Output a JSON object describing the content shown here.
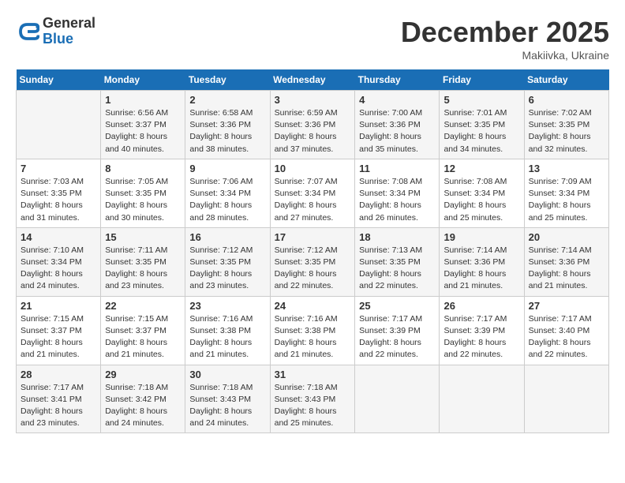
{
  "header": {
    "logo": {
      "line1": "General",
      "line2": "Blue"
    },
    "title": "December 2025",
    "location": "Makiivka, Ukraine"
  },
  "weekdays": [
    "Sunday",
    "Monday",
    "Tuesday",
    "Wednesday",
    "Thursday",
    "Friday",
    "Saturday"
  ],
  "weeks": [
    [
      {
        "day": "",
        "sunrise": "",
        "sunset": "",
        "daylight": ""
      },
      {
        "day": "1",
        "sunrise": "Sunrise: 6:56 AM",
        "sunset": "Sunset: 3:37 PM",
        "daylight": "Daylight: 8 hours and 40 minutes."
      },
      {
        "day": "2",
        "sunrise": "Sunrise: 6:58 AM",
        "sunset": "Sunset: 3:36 PM",
        "daylight": "Daylight: 8 hours and 38 minutes."
      },
      {
        "day": "3",
        "sunrise": "Sunrise: 6:59 AM",
        "sunset": "Sunset: 3:36 PM",
        "daylight": "Daylight: 8 hours and 37 minutes."
      },
      {
        "day": "4",
        "sunrise": "Sunrise: 7:00 AM",
        "sunset": "Sunset: 3:36 PM",
        "daylight": "Daylight: 8 hours and 35 minutes."
      },
      {
        "day": "5",
        "sunrise": "Sunrise: 7:01 AM",
        "sunset": "Sunset: 3:35 PM",
        "daylight": "Daylight: 8 hours and 34 minutes."
      },
      {
        "day": "6",
        "sunrise": "Sunrise: 7:02 AM",
        "sunset": "Sunset: 3:35 PM",
        "daylight": "Daylight: 8 hours and 32 minutes."
      }
    ],
    [
      {
        "day": "7",
        "sunrise": "Sunrise: 7:03 AM",
        "sunset": "Sunset: 3:35 PM",
        "daylight": "Daylight: 8 hours and 31 minutes."
      },
      {
        "day": "8",
        "sunrise": "Sunrise: 7:05 AM",
        "sunset": "Sunset: 3:35 PM",
        "daylight": "Daylight: 8 hours and 30 minutes."
      },
      {
        "day": "9",
        "sunrise": "Sunrise: 7:06 AM",
        "sunset": "Sunset: 3:34 PM",
        "daylight": "Daylight: 8 hours and 28 minutes."
      },
      {
        "day": "10",
        "sunrise": "Sunrise: 7:07 AM",
        "sunset": "Sunset: 3:34 PM",
        "daylight": "Daylight: 8 hours and 27 minutes."
      },
      {
        "day": "11",
        "sunrise": "Sunrise: 7:08 AM",
        "sunset": "Sunset: 3:34 PM",
        "daylight": "Daylight: 8 hours and 26 minutes."
      },
      {
        "day": "12",
        "sunrise": "Sunrise: 7:08 AM",
        "sunset": "Sunset: 3:34 PM",
        "daylight": "Daylight: 8 hours and 25 minutes."
      },
      {
        "day": "13",
        "sunrise": "Sunrise: 7:09 AM",
        "sunset": "Sunset: 3:34 PM",
        "daylight": "Daylight: 8 hours and 25 minutes."
      }
    ],
    [
      {
        "day": "14",
        "sunrise": "Sunrise: 7:10 AM",
        "sunset": "Sunset: 3:34 PM",
        "daylight": "Daylight: 8 hours and 24 minutes."
      },
      {
        "day": "15",
        "sunrise": "Sunrise: 7:11 AM",
        "sunset": "Sunset: 3:35 PM",
        "daylight": "Daylight: 8 hours and 23 minutes."
      },
      {
        "day": "16",
        "sunrise": "Sunrise: 7:12 AM",
        "sunset": "Sunset: 3:35 PM",
        "daylight": "Daylight: 8 hours and 23 minutes."
      },
      {
        "day": "17",
        "sunrise": "Sunrise: 7:12 AM",
        "sunset": "Sunset: 3:35 PM",
        "daylight": "Daylight: 8 hours and 22 minutes."
      },
      {
        "day": "18",
        "sunrise": "Sunrise: 7:13 AM",
        "sunset": "Sunset: 3:35 PM",
        "daylight": "Daylight: 8 hours and 22 minutes."
      },
      {
        "day": "19",
        "sunrise": "Sunrise: 7:14 AM",
        "sunset": "Sunset: 3:36 PM",
        "daylight": "Daylight: 8 hours and 21 minutes."
      },
      {
        "day": "20",
        "sunrise": "Sunrise: 7:14 AM",
        "sunset": "Sunset: 3:36 PM",
        "daylight": "Daylight: 8 hours and 21 minutes."
      }
    ],
    [
      {
        "day": "21",
        "sunrise": "Sunrise: 7:15 AM",
        "sunset": "Sunset: 3:37 PM",
        "daylight": "Daylight: 8 hours and 21 minutes."
      },
      {
        "day": "22",
        "sunrise": "Sunrise: 7:15 AM",
        "sunset": "Sunset: 3:37 PM",
        "daylight": "Daylight: 8 hours and 21 minutes."
      },
      {
        "day": "23",
        "sunrise": "Sunrise: 7:16 AM",
        "sunset": "Sunset: 3:38 PM",
        "daylight": "Daylight: 8 hours and 21 minutes."
      },
      {
        "day": "24",
        "sunrise": "Sunrise: 7:16 AM",
        "sunset": "Sunset: 3:38 PM",
        "daylight": "Daylight: 8 hours and 21 minutes."
      },
      {
        "day": "25",
        "sunrise": "Sunrise: 7:17 AM",
        "sunset": "Sunset: 3:39 PM",
        "daylight": "Daylight: 8 hours and 22 minutes."
      },
      {
        "day": "26",
        "sunrise": "Sunrise: 7:17 AM",
        "sunset": "Sunset: 3:39 PM",
        "daylight": "Daylight: 8 hours and 22 minutes."
      },
      {
        "day": "27",
        "sunrise": "Sunrise: 7:17 AM",
        "sunset": "Sunset: 3:40 PM",
        "daylight": "Daylight: 8 hours and 22 minutes."
      }
    ],
    [
      {
        "day": "28",
        "sunrise": "Sunrise: 7:17 AM",
        "sunset": "Sunset: 3:41 PM",
        "daylight": "Daylight: 8 hours and 23 minutes."
      },
      {
        "day": "29",
        "sunrise": "Sunrise: 7:18 AM",
        "sunset": "Sunset: 3:42 PM",
        "daylight": "Daylight: 8 hours and 24 minutes."
      },
      {
        "day": "30",
        "sunrise": "Sunrise: 7:18 AM",
        "sunset": "Sunset: 3:43 PM",
        "daylight": "Daylight: 8 hours and 24 minutes."
      },
      {
        "day": "31",
        "sunrise": "Sunrise: 7:18 AM",
        "sunset": "Sunset: 3:43 PM",
        "daylight": "Daylight: 8 hours and 25 minutes."
      },
      {
        "day": "",
        "sunrise": "",
        "sunset": "",
        "daylight": ""
      },
      {
        "day": "",
        "sunrise": "",
        "sunset": "",
        "daylight": ""
      },
      {
        "day": "",
        "sunrise": "",
        "sunset": "",
        "daylight": ""
      }
    ]
  ]
}
